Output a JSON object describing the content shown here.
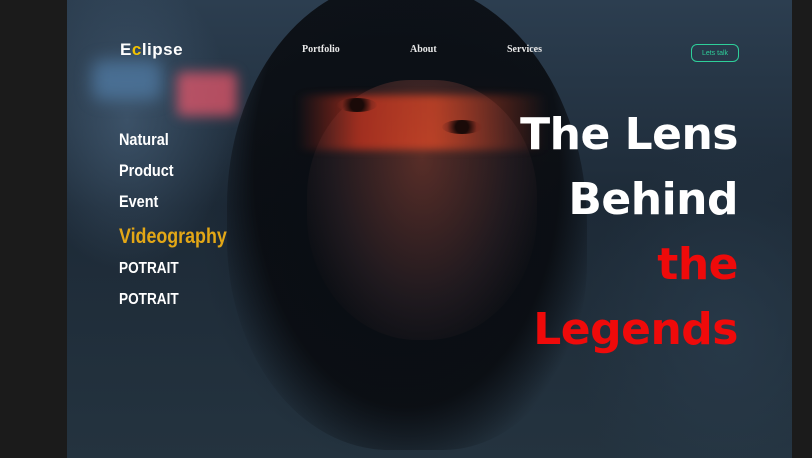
{
  "brand": {
    "logo_prefix": "E",
    "logo_mark": "c",
    "logo_suffix": "lipse"
  },
  "nav": {
    "portfolio": "Portfolio",
    "about": "About",
    "services": "Services"
  },
  "cta": {
    "label": "Lets talk",
    "color": "#2ecf9a"
  },
  "categories": [
    "Natural",
    "Product",
    "Event",
    "Videography",
    "POTRAIT",
    "POTRAIT"
  ],
  "headline": {
    "line1": "The Lens",
    "line2": "Behind",
    "line3": "the",
    "line4": "Legends"
  },
  "colors": {
    "accent_red": "#ef0a0a",
    "highlight_orange": "#e3a716",
    "logo_mark": "#f2c200"
  }
}
